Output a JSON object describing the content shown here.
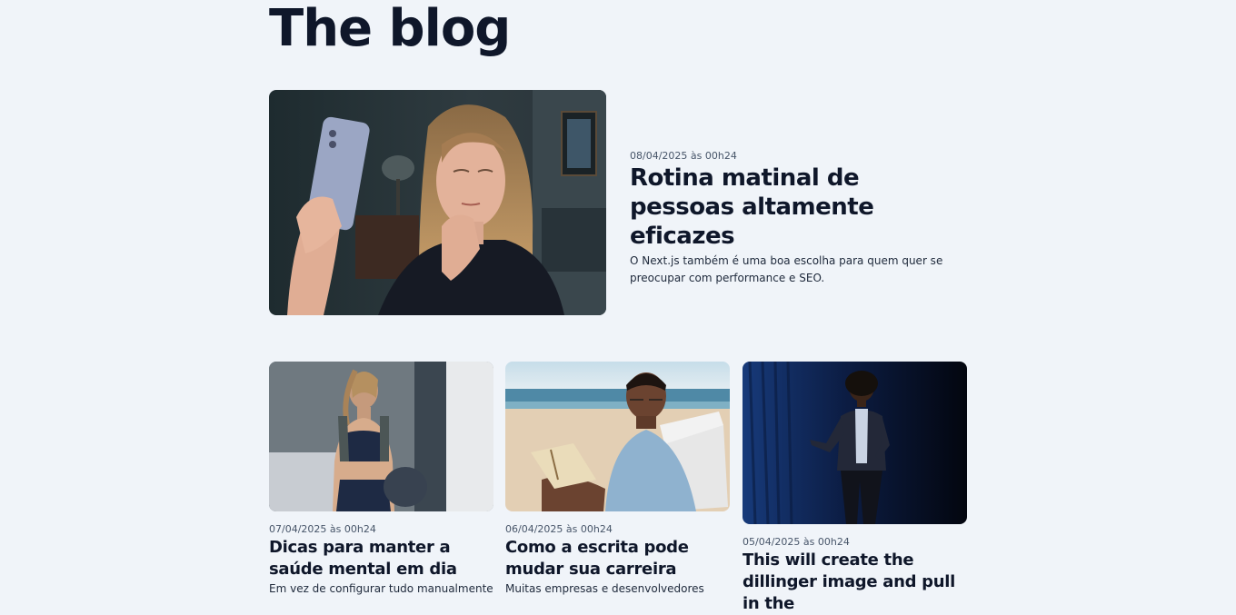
{
  "page": {
    "title": "The blog"
  },
  "featured": {
    "date": "08/04/2025 às 00h24",
    "title": "Rotina matinal de pessoas altamente eficazes",
    "excerpt": "O Next.js também é uma boa escolha para quem quer se preocupar com performance e SEO.",
    "image_alt": "woman-taking-selfie-photo"
  },
  "posts": [
    {
      "date": "07/04/2025 às 00h24",
      "title": "Dicas para manter a saúde mental em dia",
      "excerpt": "Em vez de configurar tudo manualmente",
      "image_alt": "woman-fitness-photo"
    },
    {
      "date": "06/04/2025 às 00h24",
      "title": "Como a escrita pode mudar sua carreira",
      "excerpt": "Muitas empresas e desenvolvedores",
      "image_alt": "man-reading-on-beach-photo"
    },
    {
      "date": "05/04/2025 às 00h24",
      "title": "This will create the dillinger image and pull in the",
      "excerpt": "",
      "image_alt": "woman-speaking-on-stage-photo"
    }
  ],
  "colors": {
    "background": "#f0f4f9",
    "heading": "#0f172a",
    "date": "#475569",
    "body": "#1e293b"
  }
}
